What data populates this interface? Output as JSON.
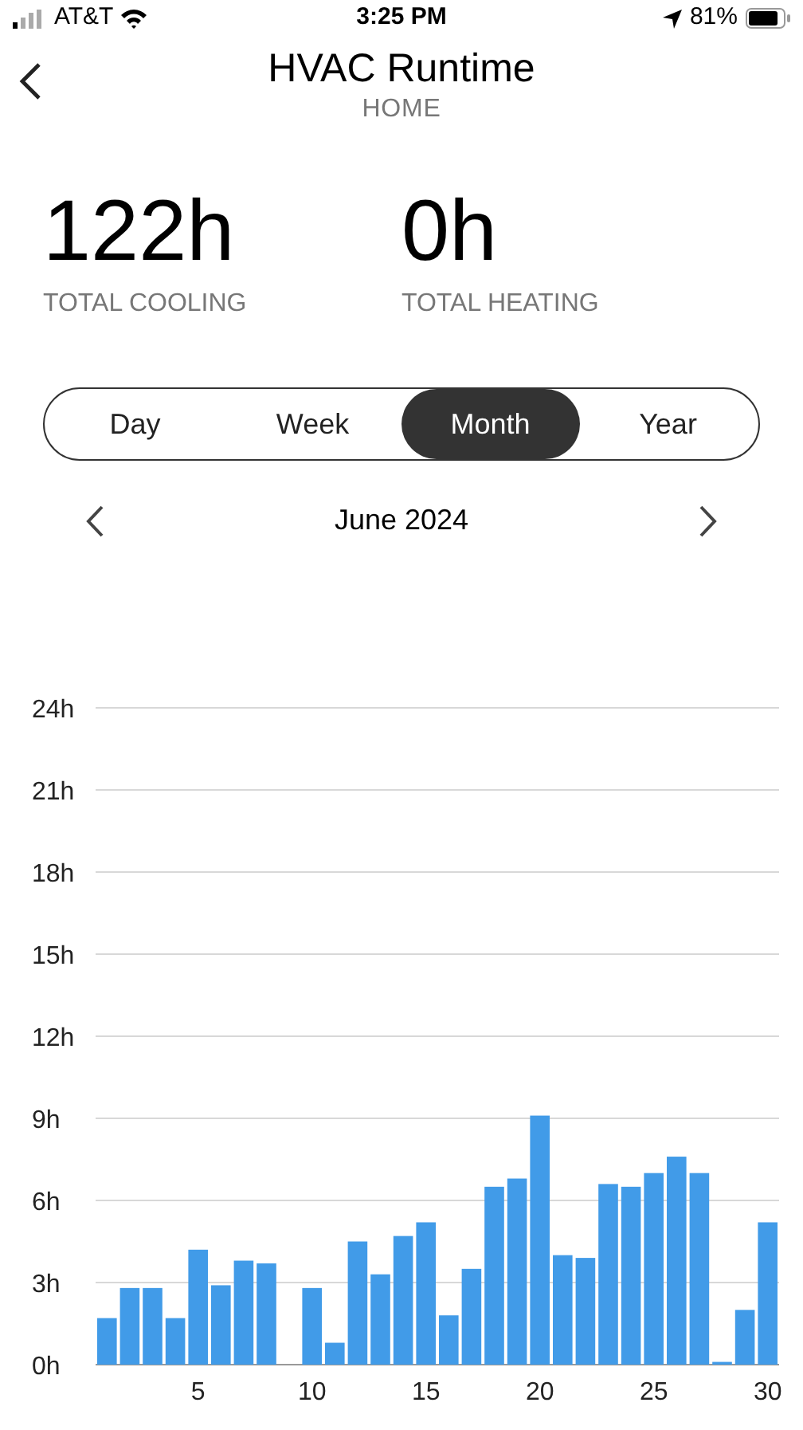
{
  "status_bar": {
    "carrier": "AT&T",
    "time": "3:25 PM",
    "battery": "81%"
  },
  "header": {
    "title": "HVAC Runtime",
    "subtitle": "HOME"
  },
  "totals": [
    {
      "value": "122h",
      "label": "TOTAL COOLING"
    },
    {
      "value": "0h",
      "label": "TOTAL HEATING"
    }
  ],
  "tabs": [
    {
      "label": "Day",
      "selected": false
    },
    {
      "label": "Week",
      "selected": false
    },
    {
      "label": "Month",
      "selected": true
    },
    {
      "label": "Year",
      "selected": false
    }
  ],
  "period": {
    "label": "June 2024"
  },
  "chart_data": {
    "type": "bar",
    "x": [
      1,
      2,
      3,
      4,
      5,
      6,
      7,
      8,
      9,
      10,
      11,
      12,
      13,
      14,
      15,
      16,
      17,
      18,
      19,
      20,
      21,
      22,
      23,
      24,
      25,
      26,
      27,
      28,
      29,
      30
    ],
    "series": [
      {
        "color": "#419be8",
        "values": [
          1.7,
          2.8,
          2.8,
          1.7,
          4.2,
          2.9,
          3.8,
          3.7,
          0,
          2.8,
          0.8,
          4.5,
          3.3,
          4.7,
          5.2,
          1.8,
          3.5,
          6.5,
          6.8,
          9.1,
          4.0,
          3.9,
          6.6,
          6.5,
          7.0,
          7.6,
          7.0,
          0.1,
          2.0,
          5.2
        ]
      }
    ],
    "xlim": [
      0.5,
      30.5
    ],
    "ylim": [
      0,
      24
    ],
    "grid": true,
    "xticks": [
      5,
      10,
      15,
      20,
      25,
      30
    ],
    "yticks": [
      {
        "value": 0,
        "label": "0h"
      },
      {
        "value": 3,
        "label": "3h"
      },
      {
        "value": 6,
        "label": "6h"
      },
      {
        "value": 9,
        "label": "9h"
      },
      {
        "value": 12,
        "label": "12h"
      },
      {
        "value": 15,
        "label": "15h"
      },
      {
        "value": 18,
        "label": "18h"
      },
      {
        "value": 21,
        "label": "21h"
      },
      {
        "value": 24,
        "label": "24h"
      }
    ]
  }
}
